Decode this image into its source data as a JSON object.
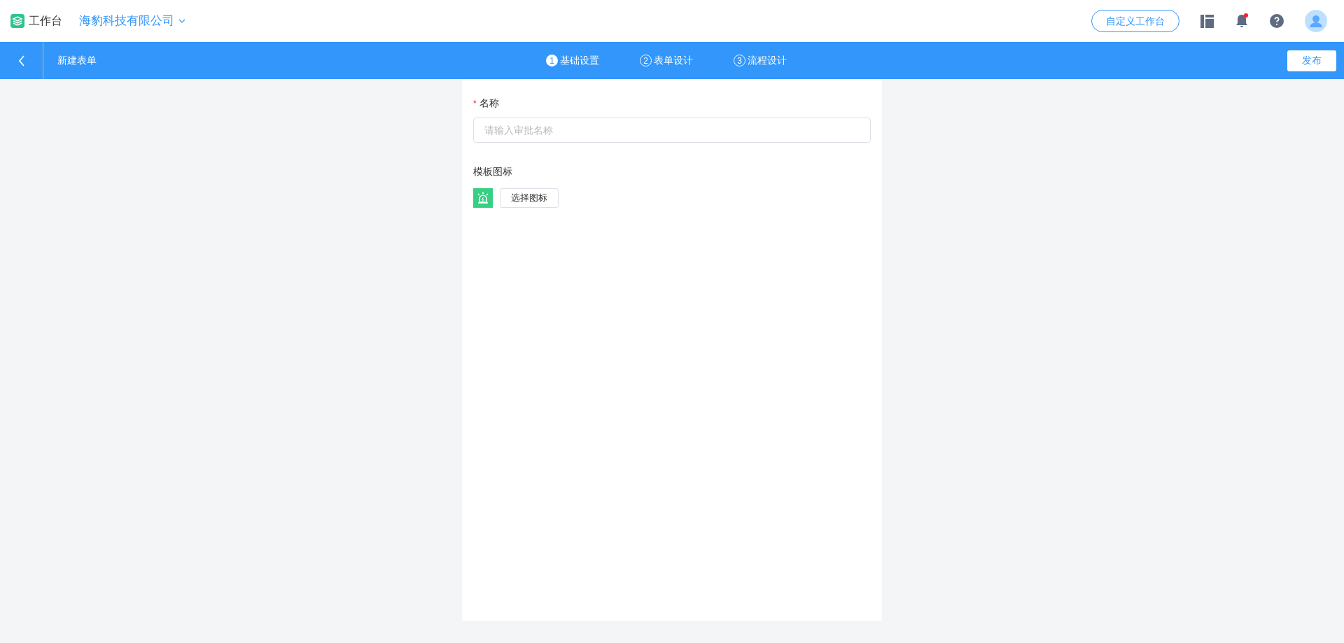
{
  "header": {
    "app_title": "工作台",
    "company": "海豹科技有限公司",
    "customize_button": "自定义工作台",
    "notifications": {
      "unread": true
    }
  },
  "toolbar": {
    "title": "新建表单",
    "publish_button": "发布"
  },
  "steps": [
    {
      "number": "1",
      "label": "基础设置",
      "selected": true
    },
    {
      "number": "2",
      "label": "表单设计",
      "selected": false
    },
    {
      "number": "3",
      "label": "流程设计",
      "selected": false
    }
  ],
  "form": {
    "name_field": {
      "required_mark": "*",
      "label": "名称",
      "placeholder": "请输入审批名称"
    },
    "icon_field": {
      "label": "模板图标",
      "button": "选择图标"
    }
  }
}
